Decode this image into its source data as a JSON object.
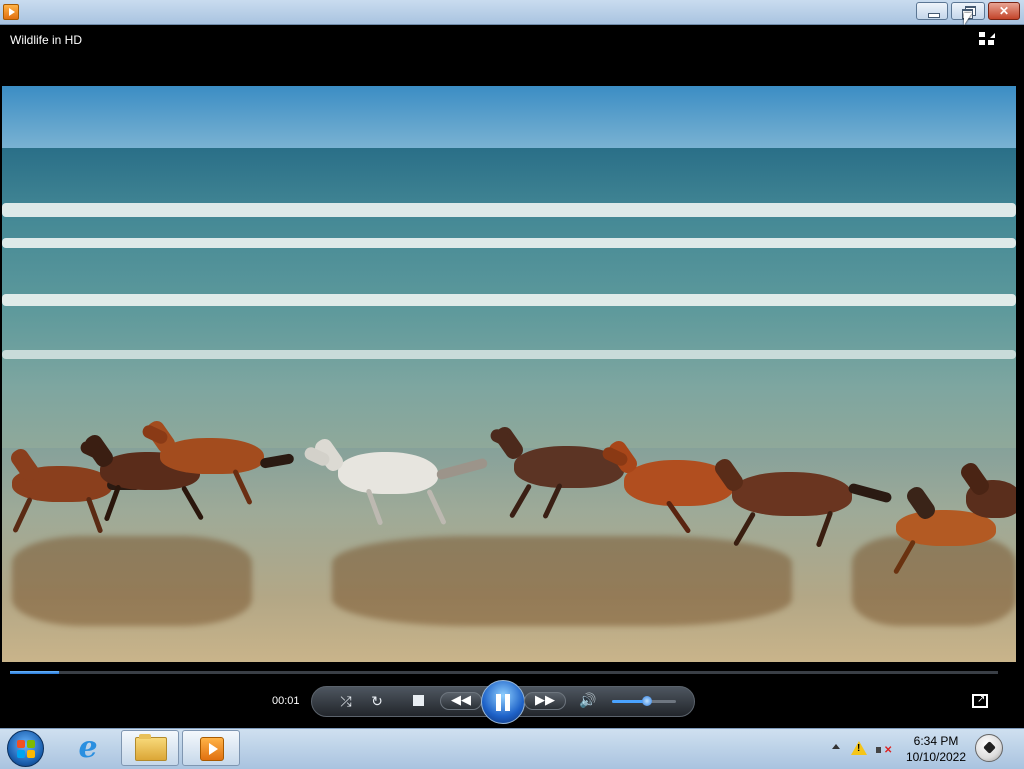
{
  "window": {
    "title": "Wildlife in HD",
    "buttons": {
      "minimize": "minimize",
      "restore": "restore",
      "close": "close"
    }
  },
  "player": {
    "elapsed_time": "00:01",
    "seek_progress": 0.05,
    "volume_level": 0.55,
    "state": "playing",
    "controls": [
      "shuffle-icon",
      "repeat-icon",
      "stop-icon",
      "previous-icon",
      "pause-icon",
      "next-icon",
      "volume-icon"
    ],
    "accent_color": "#2778d6"
  },
  "video": {
    "content": "horses-running-on-beach"
  },
  "taskbar": {
    "pinned": [
      "internet-explorer-icon",
      "windows-explorer-icon",
      "windows-media-player-icon"
    ],
    "active": "windows-media-player-icon",
    "clock": {
      "time": "6:34 PM",
      "date": "10/10/2022"
    },
    "tray_icons": [
      "show-hidden-icons-arrow",
      "action-center-warning-icon",
      "volume-muted-icon"
    ]
  }
}
